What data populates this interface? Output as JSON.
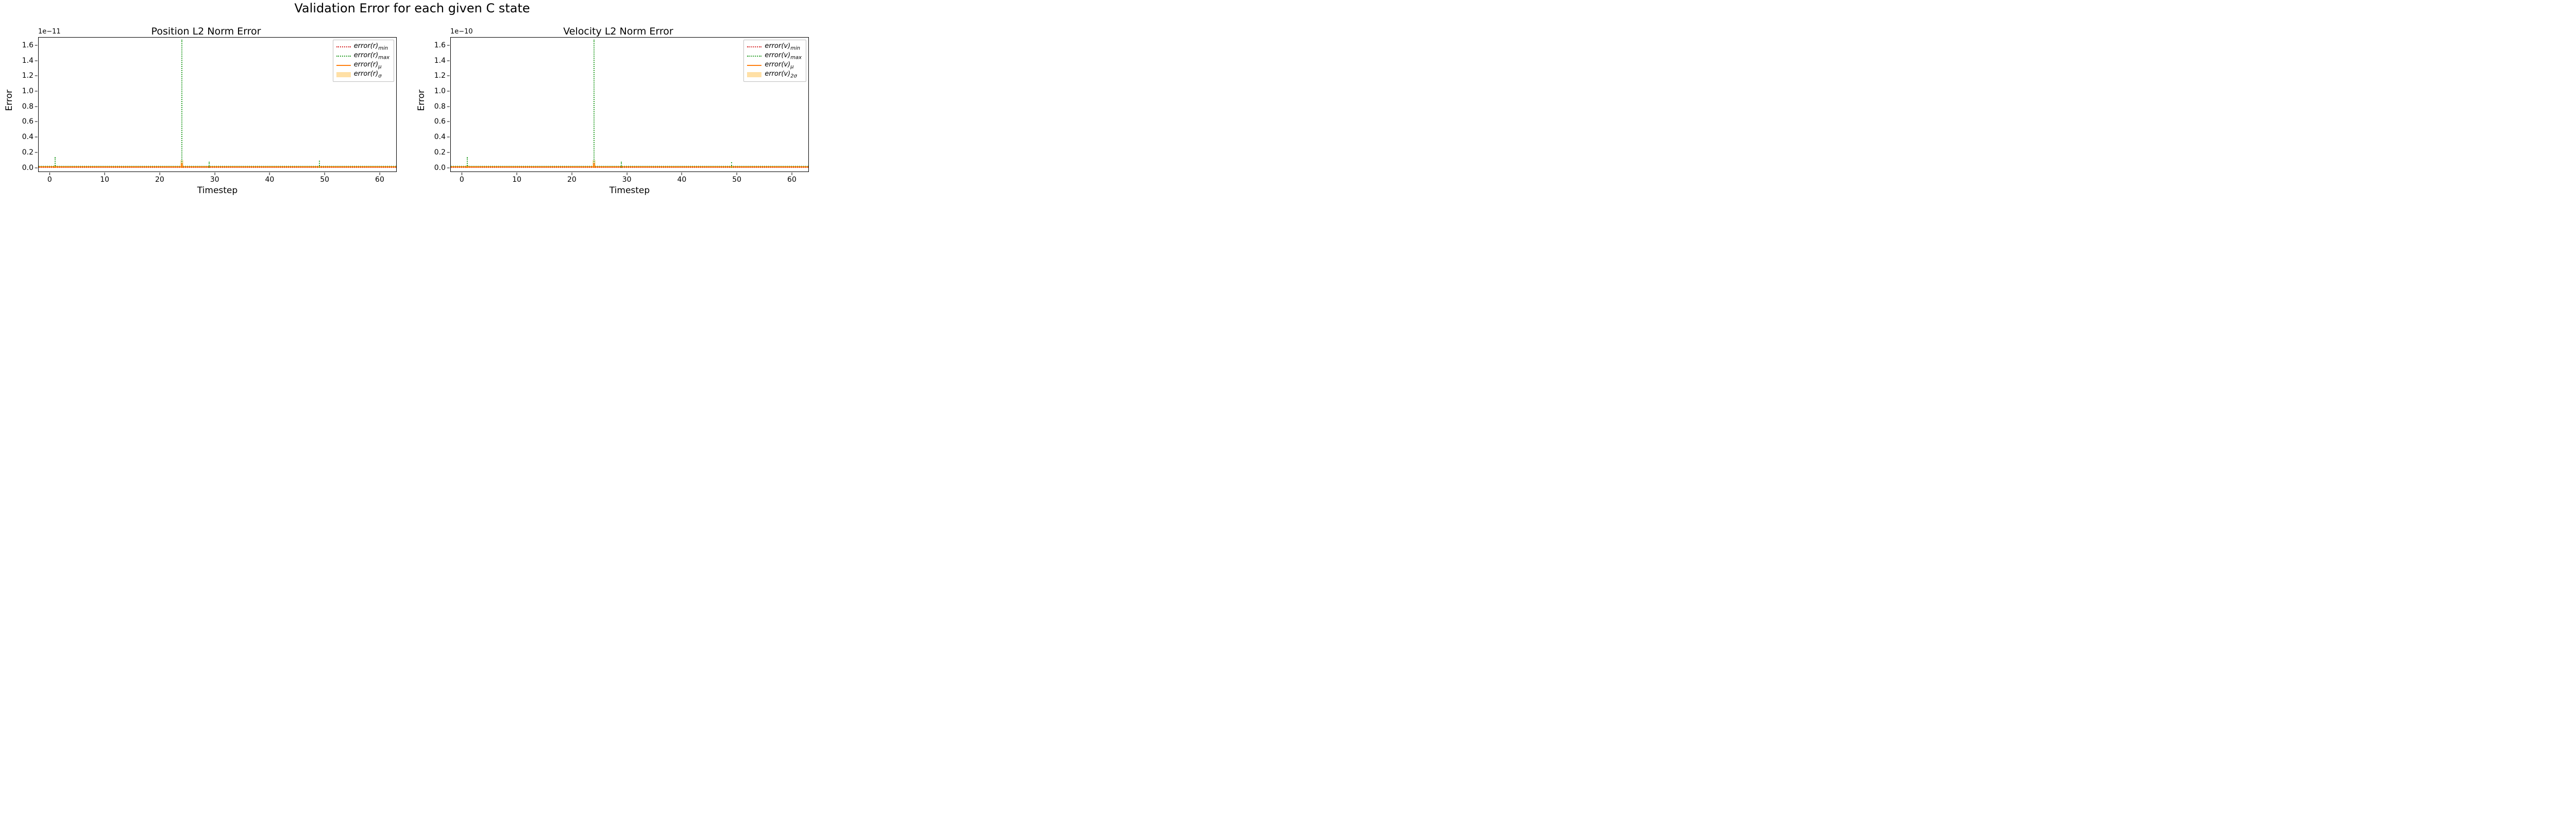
{
  "suptitle": "Validation Error for each given C state",
  "panels": [
    {
      "title": "Position L2 Norm Error",
      "offset": "1e−11",
      "xlabel": "Timestep",
      "ylabel": "Error",
      "legend": [
        {
          "label_html": "<i>error</i>(<i>r</i>)<sub>min</sub>",
          "style": "dotted",
          "color": "#d62728"
        },
        {
          "label_html": "<i>error</i>(<i>r</i>)<sub>max</sub>",
          "style": "dotted",
          "color": "#2ca02c"
        },
        {
          "label_html": "<i>error</i>(<i>r</i>)<sub>μ</sub>",
          "style": "solid",
          "color": "#ff7f0e"
        },
        {
          "label_html": "<i>error</i>(<i>r</i>)<sub>σ</sub>",
          "style": "fill",
          "color": "rgba(255,165,0,0.35)"
        }
      ]
    },
    {
      "title": "Velocity L2 Norm Error",
      "offset": "1e−10",
      "xlabel": "Timestep",
      "ylabel": "Error",
      "legend": [
        {
          "label_html": "<i>error</i>(<i>v</i>)<sub>min</sub>",
          "style": "dotted",
          "color": "#d62728"
        },
        {
          "label_html": "<i>error</i>(<i>v</i>)<sub>max</sub>",
          "style": "dotted",
          "color": "#2ca02c"
        },
        {
          "label_html": "<i>error</i>(<i>v</i>)<sub>μ</sub>",
          "style": "solid",
          "color": "#ff7f0e"
        },
        {
          "label_html": "<i>error</i>(<i>v</i>)<sub>2σ</sub>",
          "style": "fill",
          "color": "rgba(255,165,0,0.35)"
        }
      ]
    }
  ],
  "xticks": [
    0,
    10,
    20,
    30,
    40,
    50,
    60
  ],
  "yticks": [
    "0.0",
    "0.2",
    "0.4",
    "0.6",
    "0.8",
    "1.0",
    "1.2",
    "1.4",
    "1.6"
  ],
  "xlim": [
    -2,
    63
  ],
  "ylim": [
    -0.05,
    1.7
  ],
  "chart_data": [
    {
      "type": "line",
      "title": "Position L2 Norm Error",
      "xlabel": "Timestep",
      "ylabel": "Error",
      "xlim": [
        -2,
        63
      ],
      "ylim": [
        -0.05,
        1.7
      ],
      "y_scale_factor": 1e-11,
      "x": [
        0,
        1,
        2,
        3,
        4,
        5,
        6,
        7,
        8,
        9,
        10,
        11,
        12,
        13,
        14,
        15,
        16,
        17,
        18,
        19,
        20,
        21,
        22,
        23,
        24,
        25,
        26,
        27,
        28,
        29,
        30,
        31,
        32,
        33,
        34,
        35,
        36,
        37,
        38,
        39,
        40,
        41,
        42,
        43,
        44,
        45,
        46,
        47,
        48,
        49,
        50,
        51,
        52,
        53,
        54,
        55,
        56,
        57,
        58,
        59,
        60,
        61,
        62
      ],
      "series": [
        {
          "name": "error(r)_min",
          "style": "dotted",
          "color": "#d62728",
          "values": [
            0,
            0,
            0,
            0,
            0,
            0,
            0,
            0,
            0,
            0,
            0,
            0,
            0,
            0,
            0,
            0,
            0,
            0,
            0,
            0,
            0,
            0,
            0,
            0,
            0,
            0,
            0,
            0,
            0,
            0,
            0,
            0,
            0,
            0,
            0,
            0,
            0,
            0,
            0,
            0,
            0,
            0,
            0,
            0,
            0,
            0,
            0,
            0,
            0,
            0,
            0,
            0,
            0,
            0,
            0,
            0,
            0,
            0,
            0,
            0,
            0,
            0,
            0
          ]
        },
        {
          "name": "error(r)_max",
          "style": "dotted",
          "color": "#2ca02c",
          "values": [
            0.02,
            0.14,
            0.01,
            0.01,
            0.01,
            0.01,
            0.01,
            0.01,
            0.01,
            0.01,
            0.01,
            0.01,
            0.01,
            0.01,
            0.02,
            0.01,
            0.01,
            0.01,
            0.01,
            0.01,
            0.02,
            0.01,
            0.01,
            0.02,
            1.67,
            0.02,
            0.01,
            0.01,
            0.01,
            0.08,
            0.01,
            0.01,
            0.01,
            0.01,
            0.01,
            0.01,
            0.01,
            0.01,
            0.01,
            0.01,
            0.02,
            0.01,
            0.01,
            0.02,
            0.01,
            0.01,
            0.01,
            0.01,
            0.01,
            0.09,
            0.01,
            0.01,
            0.02,
            0.01,
            0.01,
            0.01,
            0.01,
            0.01,
            0.01,
            0.01,
            0.01,
            0.01,
            0.01
          ]
        },
        {
          "name": "error(r)_mu",
          "style": "solid",
          "color": "#ff7f0e",
          "values": [
            0.005,
            0.02,
            0.005,
            0.005,
            0.005,
            0.005,
            0.005,
            0.005,
            0.005,
            0.005,
            0.005,
            0.005,
            0.005,
            0.005,
            0.005,
            0.005,
            0.005,
            0.005,
            0.005,
            0.005,
            0.005,
            0.005,
            0.005,
            0.005,
            0.06,
            0.005,
            0.005,
            0.005,
            0.005,
            0.01,
            0.005,
            0.005,
            0.005,
            0.005,
            0.005,
            0.005,
            0.005,
            0.005,
            0.005,
            0.005,
            0.005,
            0.005,
            0.005,
            0.005,
            0.005,
            0.005,
            0.005,
            0.005,
            0.005,
            0.01,
            0.005,
            0.005,
            0.005,
            0.005,
            0.005,
            0.005,
            0.005,
            0.005,
            0.005,
            0.005,
            0.005,
            0.005,
            0.005
          ]
        },
        {
          "name": "error(r)_sigma",
          "style": "fill",
          "color": "rgba(255,165,0,0.35)",
          "values": [
            0.01,
            0.03,
            0.01,
            0.01,
            0.01,
            0.01,
            0.01,
            0.01,
            0.01,
            0.01,
            0.01,
            0.01,
            0.01,
            0.01,
            0.01,
            0.01,
            0.01,
            0.01,
            0.01,
            0.01,
            0.01,
            0.01,
            0.01,
            0.01,
            0.1,
            0.01,
            0.01,
            0.01,
            0.01,
            0.02,
            0.01,
            0.01,
            0.01,
            0.01,
            0.01,
            0.01,
            0.01,
            0.01,
            0.01,
            0.01,
            0.01,
            0.01,
            0.01,
            0.01,
            0.01,
            0.01,
            0.01,
            0.01,
            0.01,
            0.02,
            0.01,
            0.01,
            0.01,
            0.01,
            0.01,
            0.01,
            0.01,
            0.01,
            0.01,
            0.01,
            0.01,
            0.01,
            0.01
          ]
        }
      ]
    },
    {
      "type": "line",
      "title": "Velocity L2 Norm Error",
      "xlabel": "Timestep",
      "ylabel": "Error",
      "xlim": [
        -2,
        63
      ],
      "ylim": [
        -0.05,
        1.7
      ],
      "y_scale_factor": 1e-10,
      "x": [
        0,
        1,
        2,
        3,
        4,
        5,
        6,
        7,
        8,
        9,
        10,
        11,
        12,
        13,
        14,
        15,
        16,
        17,
        18,
        19,
        20,
        21,
        22,
        23,
        24,
        25,
        26,
        27,
        28,
        29,
        30,
        31,
        32,
        33,
        34,
        35,
        36,
        37,
        38,
        39,
        40,
        41,
        42,
        43,
        44,
        45,
        46,
        47,
        48,
        49,
        50,
        51,
        52,
        53,
        54,
        55,
        56,
        57,
        58,
        59,
        60,
        61,
        62
      ],
      "series": [
        {
          "name": "error(v)_min",
          "style": "dotted",
          "color": "#d62728",
          "values": [
            0,
            0,
            0,
            0,
            0,
            0,
            0,
            0,
            0,
            0,
            0,
            0,
            0,
            0,
            0,
            0,
            0,
            0,
            0,
            0,
            0,
            0,
            0,
            0,
            0,
            0,
            0,
            0,
            0,
            0,
            0,
            0,
            0,
            0,
            0,
            0,
            0,
            0,
            0,
            0,
            0,
            0,
            0,
            0,
            0,
            0,
            0,
            0,
            0,
            0,
            0,
            0,
            0,
            0,
            0,
            0,
            0,
            0,
            0,
            0,
            0,
            0,
            0
          ]
        },
        {
          "name": "error(v)_max",
          "style": "dotted",
          "color": "#2ca02c",
          "values": [
            0.02,
            0.14,
            0.01,
            0.01,
            0.01,
            0.01,
            0.01,
            0.01,
            0.01,
            0.01,
            0.01,
            0.01,
            0.01,
            0.01,
            0.02,
            0.01,
            0.01,
            0.01,
            0.01,
            0.01,
            0.02,
            0.01,
            0.01,
            0.02,
            1.67,
            0.02,
            0.01,
            0.01,
            0.01,
            0.08,
            0.01,
            0.01,
            0.01,
            0.01,
            0.01,
            0.01,
            0.01,
            0.01,
            0.01,
            0.01,
            0.02,
            0.01,
            0.01,
            0.02,
            0.01,
            0.01,
            0.01,
            0.01,
            0.01,
            0.07,
            0.01,
            0.01,
            0.02,
            0.01,
            0.01,
            0.01,
            0.01,
            0.01,
            0.01,
            0.01,
            0.01,
            0.01,
            0.01
          ]
        },
        {
          "name": "error(v)_mu",
          "style": "solid",
          "color": "#ff7f0e",
          "values": [
            0.005,
            0.02,
            0.005,
            0.005,
            0.005,
            0.005,
            0.005,
            0.005,
            0.005,
            0.005,
            0.005,
            0.005,
            0.005,
            0.005,
            0.005,
            0.005,
            0.005,
            0.005,
            0.005,
            0.005,
            0.005,
            0.005,
            0.005,
            0.005,
            0.06,
            0.005,
            0.005,
            0.005,
            0.005,
            0.01,
            0.005,
            0.005,
            0.005,
            0.005,
            0.005,
            0.005,
            0.005,
            0.005,
            0.005,
            0.005,
            0.005,
            0.005,
            0.005,
            0.005,
            0.005,
            0.005,
            0.005,
            0.005,
            0.005,
            0.01,
            0.005,
            0.005,
            0.005,
            0.005,
            0.005,
            0.005,
            0.005,
            0.005,
            0.005,
            0.005,
            0.005,
            0.005,
            0.005
          ]
        },
        {
          "name": "error(v)_2sigma",
          "style": "fill",
          "color": "rgba(255,165,0,0.35)",
          "values": [
            0.01,
            0.03,
            0.01,
            0.01,
            0.01,
            0.01,
            0.01,
            0.01,
            0.01,
            0.01,
            0.01,
            0.01,
            0.01,
            0.01,
            0.01,
            0.01,
            0.01,
            0.01,
            0.01,
            0.01,
            0.01,
            0.01,
            0.01,
            0.01,
            0.1,
            0.01,
            0.01,
            0.01,
            0.01,
            0.02,
            0.01,
            0.01,
            0.01,
            0.01,
            0.01,
            0.01,
            0.01,
            0.01,
            0.01,
            0.01,
            0.01,
            0.01,
            0.01,
            0.01,
            0.01,
            0.01,
            0.01,
            0.01,
            0.01,
            0.02,
            0.01,
            0.01,
            0.01,
            0.01,
            0.01,
            0.01,
            0.01,
            0.01,
            0.01,
            0.01,
            0.01,
            0.01,
            0.01
          ]
        }
      ]
    }
  ]
}
